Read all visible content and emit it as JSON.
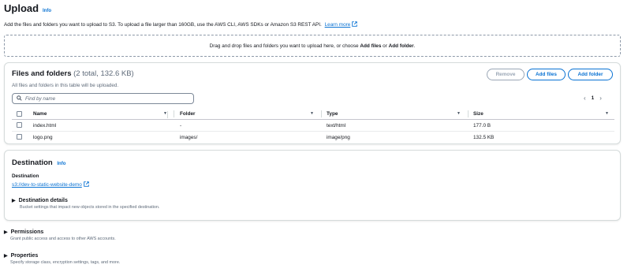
{
  "header": {
    "title": "Upload",
    "info": "Info",
    "description": "Add the files and folders you want to upload to S3. To upload a file larger than 160GB, use the AWS CLI, AWS SDKs or Amazon S3 REST API.",
    "learn_more": "Learn more"
  },
  "dropzone": {
    "text_before": "Drag and drop files and folders you want to upload here, or choose",
    "add_files": "Add files",
    "or": "or",
    "add_folder": "Add folder",
    "period": "."
  },
  "files": {
    "title": "Files and folders",
    "count": "(2 total, 132.6 KB)",
    "subtitle": "All files and folders in this table will be uploaded.",
    "remove_label": "Remove",
    "add_files_label": "Add files",
    "add_folder_label": "Add folder",
    "search_placeholder": "Find by name",
    "page": "1",
    "columns": [
      "Name",
      "Folder",
      "Type",
      "Size"
    ],
    "rows": [
      {
        "name": "index.html",
        "folder": "-",
        "type": "text/html",
        "size": "177.0 B"
      },
      {
        "name": "logo.png",
        "folder": "images/",
        "type": "image/png",
        "size": "132.5 KB"
      }
    ]
  },
  "destination": {
    "title": "Destination",
    "info": "Info",
    "label": "Destination",
    "link": "s3://dev-to-static-website-demo",
    "details_title": "Destination details",
    "details_sub": "Bucket settings that impact new objects stored in the specified destination."
  },
  "permissions": {
    "title": "Permissions",
    "sub": "Grant public access and access to other AWS accounts."
  },
  "properties": {
    "title": "Properties",
    "sub": "Specify storage class, encryption settings, tags, and more."
  },
  "icons": {
    "external_link": "external-link-icon",
    "search": "search-icon",
    "caret": "caret-down-icon",
    "expand": "caret-right-icon"
  },
  "colors": {
    "link": "#0972d3",
    "text": "#16191f",
    "muted": "#5f6b7a",
    "border": "#d5dbdb"
  }
}
